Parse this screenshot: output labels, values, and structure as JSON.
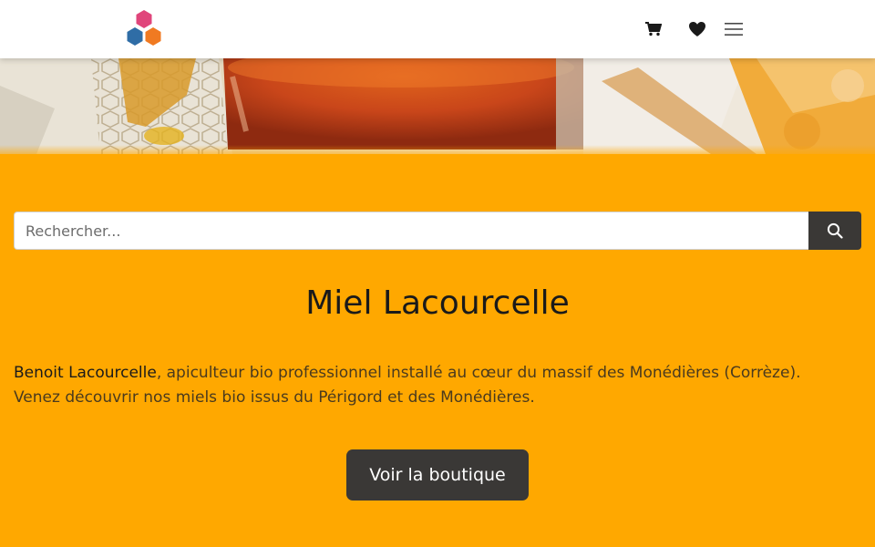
{
  "header": {
    "logo_icon": "hexagon-cluster-logo",
    "cart_icon": "shopping-cart-icon",
    "wishlist_icon": "heart-icon",
    "menu_icon": "hamburger-menu-icon"
  },
  "colors": {
    "background": "#FFA800",
    "header": "#FFFFFF",
    "button": "#3A3836",
    "logo_pink": "#E0457B",
    "logo_blue": "#2F6DA6",
    "logo_orange": "#F07A22"
  },
  "search": {
    "placeholder": "Rechercher...",
    "value": "",
    "button_icon": "search-icon"
  },
  "main": {
    "title": "Miel Lacourcelle",
    "intro_name": "Benoit Lacourcelle",
    "intro_rest": ", apiculteur bio professionnel installé au cœur du massif des Monédières (Corrèze).",
    "intro_line2": "Venez découvrir nos miels bio issus du Périgord et des Monédières.",
    "cta_label": "Voir la boutique"
  }
}
